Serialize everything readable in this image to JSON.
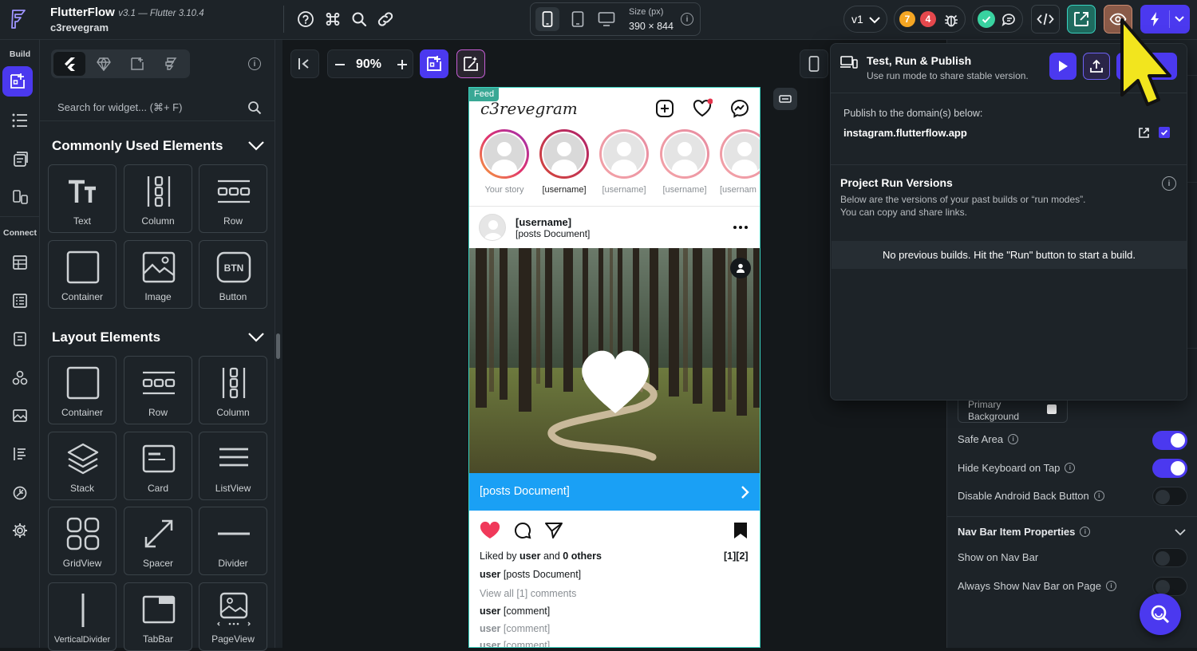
{
  "app": {
    "name": "FlutterFlow",
    "version": "v3.1 — Flutter 3.10.4",
    "project": "c3revegram"
  },
  "topbar": {
    "size_label": "Size (px)",
    "size_value": "390 × 844",
    "version_select": "v1",
    "warnings_count": "7",
    "errors_count": "4"
  },
  "rail": {
    "build_label": "Build",
    "connect_label": "Connect"
  },
  "panel": {
    "search_placeholder": "Search for widget... (⌘+ F)",
    "common_title": "Commonly Used Elements",
    "layout_title": "Layout Elements",
    "common_items": [
      "Text",
      "Column",
      "Row",
      "Container",
      "Image",
      "Button"
    ],
    "layout_items": [
      "Container",
      "Row",
      "Column",
      "Stack",
      "Card",
      "ListView",
      "GridView",
      "Spacer",
      "Divider",
      "VerticalDivider",
      "TabBar",
      "PageView"
    ]
  },
  "canvas": {
    "zoom": "90%"
  },
  "phone": {
    "page_tag": "Feed",
    "logo": "c3revegram",
    "stories": [
      "Your story",
      "[username]",
      "[username]",
      "[username]",
      "[usernam"
    ],
    "post_user": "[username]",
    "post_sub": "[posts Document]",
    "bar_text": "[posts Document]",
    "liked_prefix": "Liked by",
    "liked_user": "user",
    "liked_and": "and",
    "liked_others": "0 others",
    "page_counter": "[1][2]",
    "caption_user": "user",
    "caption_text": "[posts Document]",
    "view_all": "View all [1] comments",
    "comments": [
      {
        "user": "user",
        "text": "[comment]"
      },
      {
        "user": "user",
        "text": "[comment]"
      },
      {
        "user": "user",
        "text": "[comment]"
      }
    ]
  },
  "popup": {
    "title": "Test, Run & Publish",
    "subtitle": "Use run mode to share stable version.",
    "publish_label": "Publish to the domain(s) below:",
    "domain": "instagram.flutterflow.app",
    "versions_title": "Project Run Versions",
    "versions_desc1": "Below are the versions of your past builds or “run modes”.",
    "versions_desc2": "You can copy and share links.",
    "empty_msg": "No previous builds. Hit the \"Run\" button to start a build."
  },
  "props": {
    "bg_label": "Primary Background",
    "safe_area": "Safe Area",
    "hide_keyboard": "Hide Keyboard on Tap",
    "disable_back": "Disable Android Back Button",
    "navbar_section": "Nav Bar Item Properties",
    "show_navbar": "Show on Nav Bar",
    "always_navbar": "Always Show Nav Bar on Page"
  },
  "colors": {
    "accent": "#4b39ef",
    "phone_bar": "#1aa0f5",
    "warn": "#f5a623",
    "error": "#e5484d",
    "ok": "#39d2a0"
  }
}
